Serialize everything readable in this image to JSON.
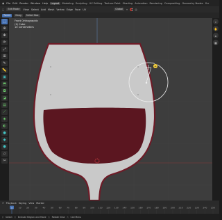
{
  "menubar": {
    "menus": [
      "File",
      "Edit",
      "Render",
      "Window",
      "Help"
    ],
    "workspaces": [
      "Layout",
      "Modeling",
      "Sculpting",
      "UV Editing",
      "Texture Paint",
      "Shading",
      "Animation",
      "Rendering",
      "Compositing",
      "Geometry Nodes",
      "Scr"
    ],
    "active_workspace_index": 0
  },
  "header": {
    "mode": "Edit Mode",
    "menus": [
      "View",
      "Select",
      "Add",
      "Mesh",
      "Vertex",
      "Edge",
      "Face",
      "UV"
    ],
    "orientation": "Global"
  },
  "tool_options": {
    "options": [
      "Tweak",
      "Drag",
      "Select Box"
    ]
  },
  "viewport": {
    "overlay_lines": [
      "Front Orthographic",
      "(1) Cube",
      "10 Centimeters"
    ],
    "glass_color": "#c9c9c9",
    "wine_color": "#5b1620",
    "outline_color": "#6e1b27",
    "background_color": "#3d3d3d"
  },
  "timeline": {
    "menus": [
      "Playback",
      "Keying",
      "View",
      "Marker"
    ],
    "current_frame": "1",
    "ticks": [
      "0",
      "10",
      "20",
      "30",
      "40",
      "50",
      "60",
      "70",
      "80",
      "90",
      "100",
      "110",
      "120",
      "130",
      "140",
      "150",
      "160",
      "170",
      "180",
      "190",
      "200",
      "210",
      "220",
      "230",
      "240",
      "250"
    ]
  },
  "statusbar": {
    "items": [
      "Select",
      "Extrude Region and Move",
      "Rotate View",
      "Call Menu"
    ]
  },
  "icons": [
    "select-box-icon",
    "cursor-icon",
    "move-icon",
    "rotate-icon",
    "scale-icon",
    "transform-icon",
    "annotate-icon",
    "measure-icon",
    "add-cube-icon",
    "extrude-icon",
    "inset-icon",
    "bevel-icon",
    "loop-cut-icon",
    "knife-icon",
    "poly-build-icon",
    "spin-icon",
    "smooth-icon",
    "edge-slide-icon",
    "shrink-icon",
    "shear-icon",
    "rip-icon"
  ]
}
